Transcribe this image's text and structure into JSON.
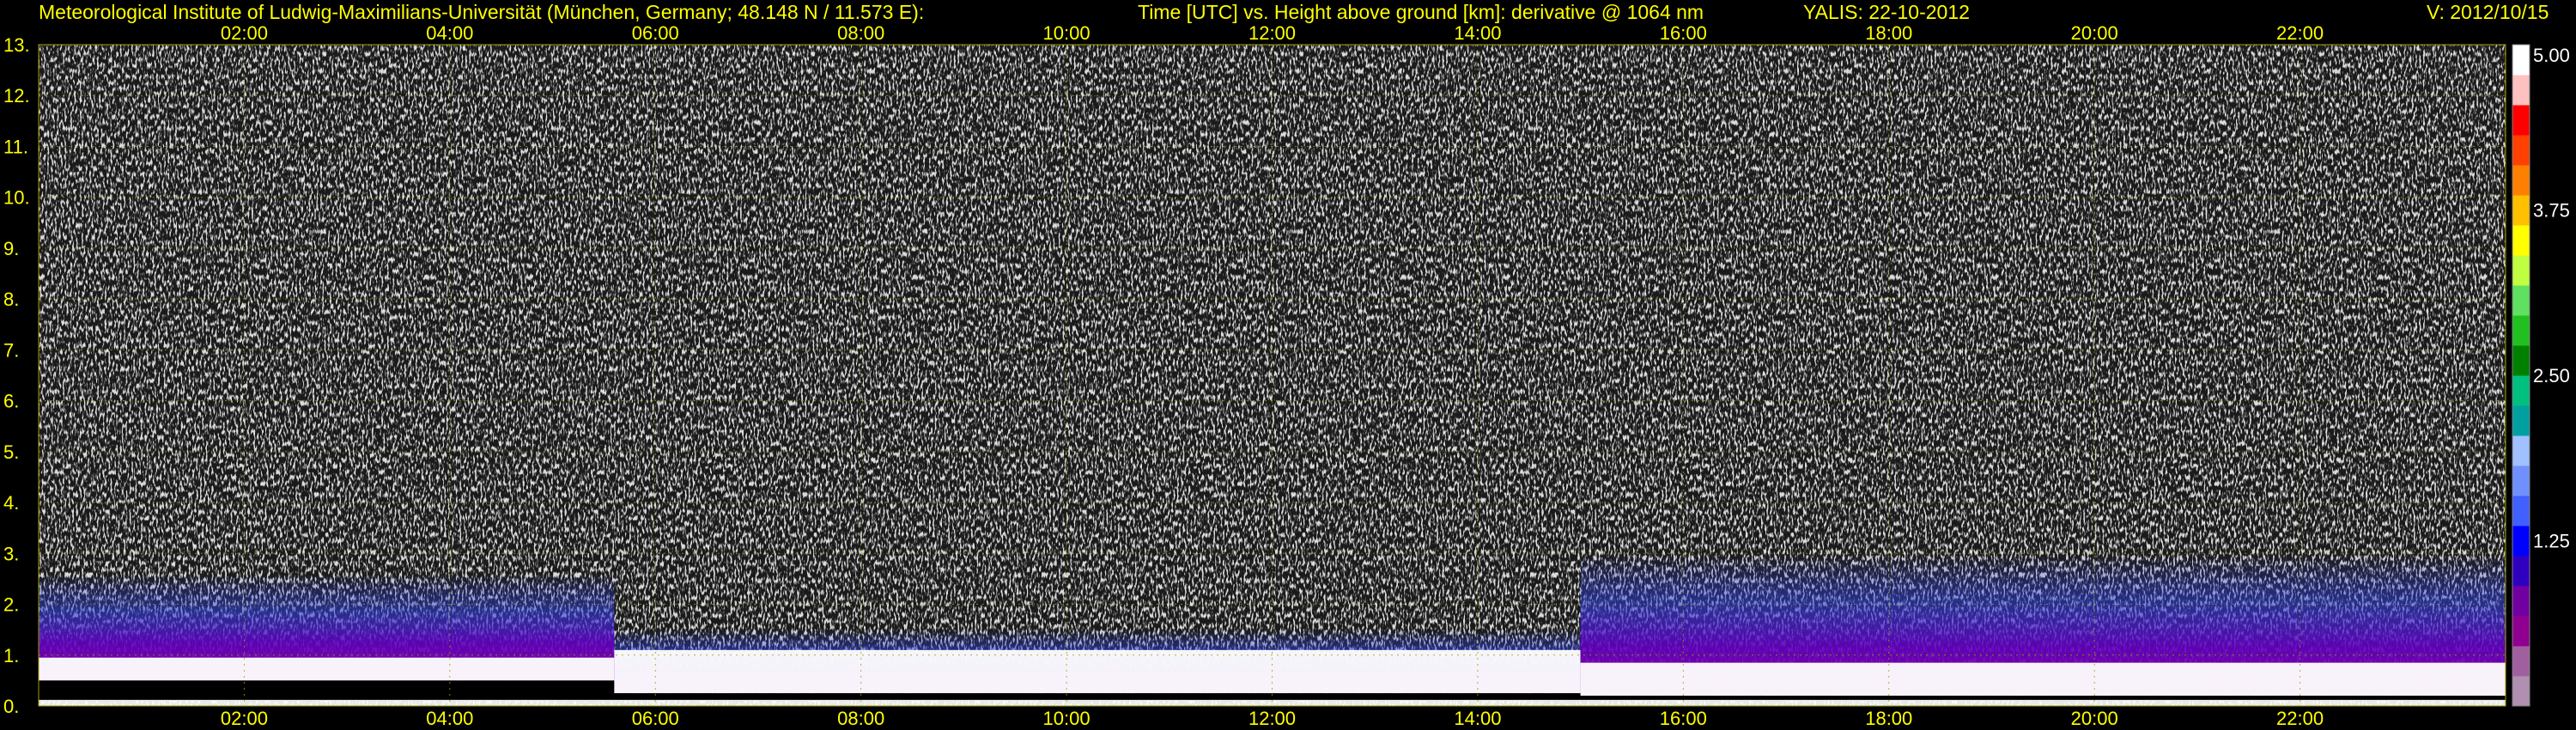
{
  "header": {
    "institute": "Meteorological Institute of Ludwig-Maximilians-Universität (München, Germany; 48.148 N / 11.573 E):",
    "axes_title": "Time [UTC] vs. Height above ground [km]: derivative @ 1064 nm",
    "instrument": "YALIS: 22-10-2012",
    "version": "V: 2012/10/15"
  },
  "colors": {
    "text": "#ffff00",
    "grid": "#a0a000",
    "background": "#000000"
  },
  "chart_data": {
    "type": "heatmap",
    "x_ticks": [
      "02:00",
      "04:00",
      "06:00",
      "08:00",
      "10:00",
      "12:00",
      "14:00",
      "16:00",
      "18:00",
      "20:00",
      "22:00"
    ],
    "x_tick_hours": [
      2,
      4,
      6,
      8,
      10,
      12,
      14,
      16,
      18,
      20,
      22
    ],
    "xlim_hours": [
      0,
      24
    ],
    "y_ticks": [
      "0.",
      "1.",
      "2.",
      "3.",
      "4.",
      "5.",
      "6.",
      "7.",
      "8.",
      "9.",
      "10.",
      "11.",
      "12.",
      "13."
    ],
    "y_tick_values": [
      0,
      1,
      2,
      3,
      4,
      5,
      6,
      7,
      8,
      9,
      10,
      11,
      12,
      13
    ],
    "ylim": [
      0,
      13
    ],
    "grid": true,
    "colorbar": {
      "labels": [
        "1.25",
        "2.50",
        "3.75",
        "5.00"
      ],
      "values": [
        1.25,
        2.5,
        3.75,
        5.0
      ],
      "range": [
        0,
        5
      ],
      "colors": [
        "#b090b0",
        "#a060a0",
        "#900090",
        "#7000a0",
        "#3000c0",
        "#0000ff",
        "#4060ff",
        "#7090ff",
        "#a0c0ff",
        "#00a0a0",
        "#00c080",
        "#008000",
        "#20c020",
        "#60e060",
        "#c0ff40",
        "#ffff00",
        "#ffc000",
        "#ff8000",
        "#ff4000",
        "#ff0000",
        "#ffc0c0",
        "#ffffff"
      ]
    },
    "layers": [
      {
        "t_start": 0.0,
        "t_end": 5.6,
        "top_km": 2.6,
        "core_km": [
          0.5,
          0.95
        ]
      },
      {
        "t_start": 5.6,
        "t_end": 15.0,
        "top_km": 1.5,
        "core_km": [
          0.25,
          1.1
        ]
      },
      {
        "t_start": 15.0,
        "t_end": 24.0,
        "top_km": 3.0,
        "core_km": [
          0.2,
          0.85
        ]
      }
    ]
  }
}
